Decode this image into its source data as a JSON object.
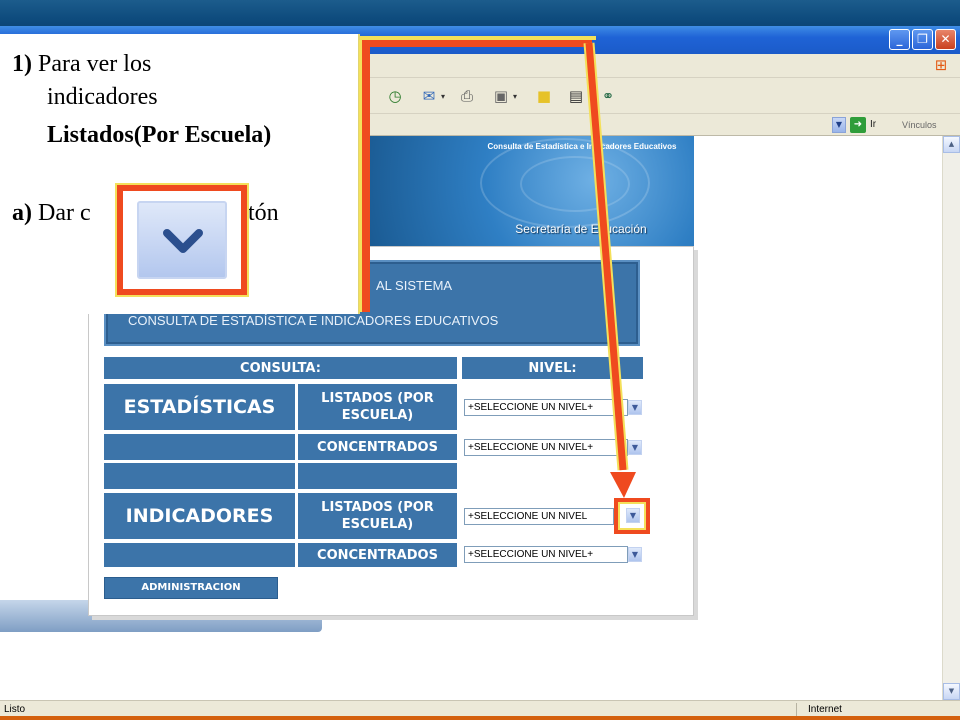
{
  "browser": {
    "window_buttons": [
      "_",
      "❐",
      "✕"
    ],
    "go_label": "Ir",
    "links_label": "Vínculos",
    "status_left": "Listo",
    "status_right": "Internet"
  },
  "banner": {
    "title": "Consulta de Estadística e Indicadores Educativos",
    "organization": "Secretaría de Educación"
  },
  "welcome": {
    "line1": "AL SISTEMA",
    "line2": "CONSULTA DE ESTADÍSTICA E INDICADORES EDUCATIVOS"
  },
  "table": {
    "header_consulta": "CONSULTA:",
    "header_nivel": "NIVEL:",
    "estadisticas": "ESTADÍSTICAS",
    "indicadores": "INDICADORES",
    "listados": "LISTADOS (POR ESCUELA)",
    "concentrados": "CONCENTRADOS",
    "select_value": "+SELECCIONE UN NIVEL+",
    "select_value_partial": "+SELECCIONE UN NIVEL"
  },
  "admin_button": "ADMINISTRACION",
  "callout": {
    "step_number": "1)",
    "line1": "Para ver los",
    "line2": "indicadores",
    "line3": "Listados(Por Escuela)",
    "sub_letter": "a)",
    "sub_text_left": "Dar c",
    "sub_text_right": "otón"
  },
  "colors": {
    "accent_red": "#ef4a1f",
    "accent_yellow": "#f4e05a",
    "cell_blue": "#3c74a9"
  }
}
